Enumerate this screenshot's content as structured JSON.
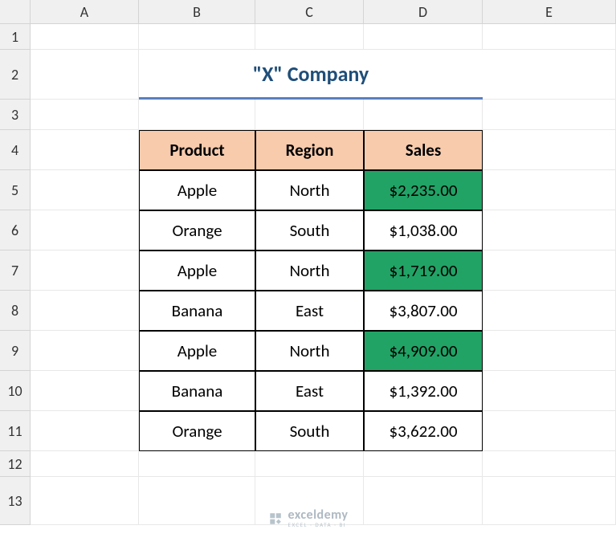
{
  "columns": [
    "A",
    "B",
    "C",
    "D",
    "E"
  ],
  "rows": [
    "1",
    "2",
    "3",
    "4",
    "5",
    "6",
    "7",
    "8",
    "9",
    "10",
    "11",
    "12",
    "13"
  ],
  "title": "\"X\" Company",
  "headers": {
    "product": "Product",
    "region": "Region",
    "sales": "Sales"
  },
  "data": [
    {
      "product": "Apple",
      "region": "North",
      "sales": "$2,235.00",
      "highlight": true
    },
    {
      "product": "Orange",
      "region": "South",
      "sales": "$1,038.00",
      "highlight": false
    },
    {
      "product": "Apple",
      "region": "North",
      "sales": "$1,719.00",
      "highlight": true
    },
    {
      "product": "Banana",
      "region": "East",
      "sales": "$3,807.00",
      "highlight": false
    },
    {
      "product": "Apple",
      "region": "North",
      "sales": "$4,909.00",
      "highlight": true
    },
    {
      "product": "Banana",
      "region": "East",
      "sales": "$1,392.00",
      "highlight": false
    },
    {
      "product": "Orange",
      "region": "South",
      "sales": "$3,622.00",
      "highlight": false
    }
  ],
  "watermark": {
    "brand": "exceldemy",
    "tagline": "EXCEL · DATA · BI"
  },
  "chart_data": {
    "type": "table",
    "title": "\"X\" Company",
    "columns": [
      "Product",
      "Region",
      "Sales"
    ],
    "rows": [
      [
        "Apple",
        "North",
        2235.0
      ],
      [
        "Orange",
        "South",
        1038.0
      ],
      [
        "Apple",
        "North",
        1719.0
      ],
      [
        "Banana",
        "East",
        3807.0
      ],
      [
        "Apple",
        "North",
        4909.0
      ],
      [
        "Banana",
        "East",
        1392.0
      ],
      [
        "Orange",
        "South",
        3622.0
      ]
    ]
  }
}
